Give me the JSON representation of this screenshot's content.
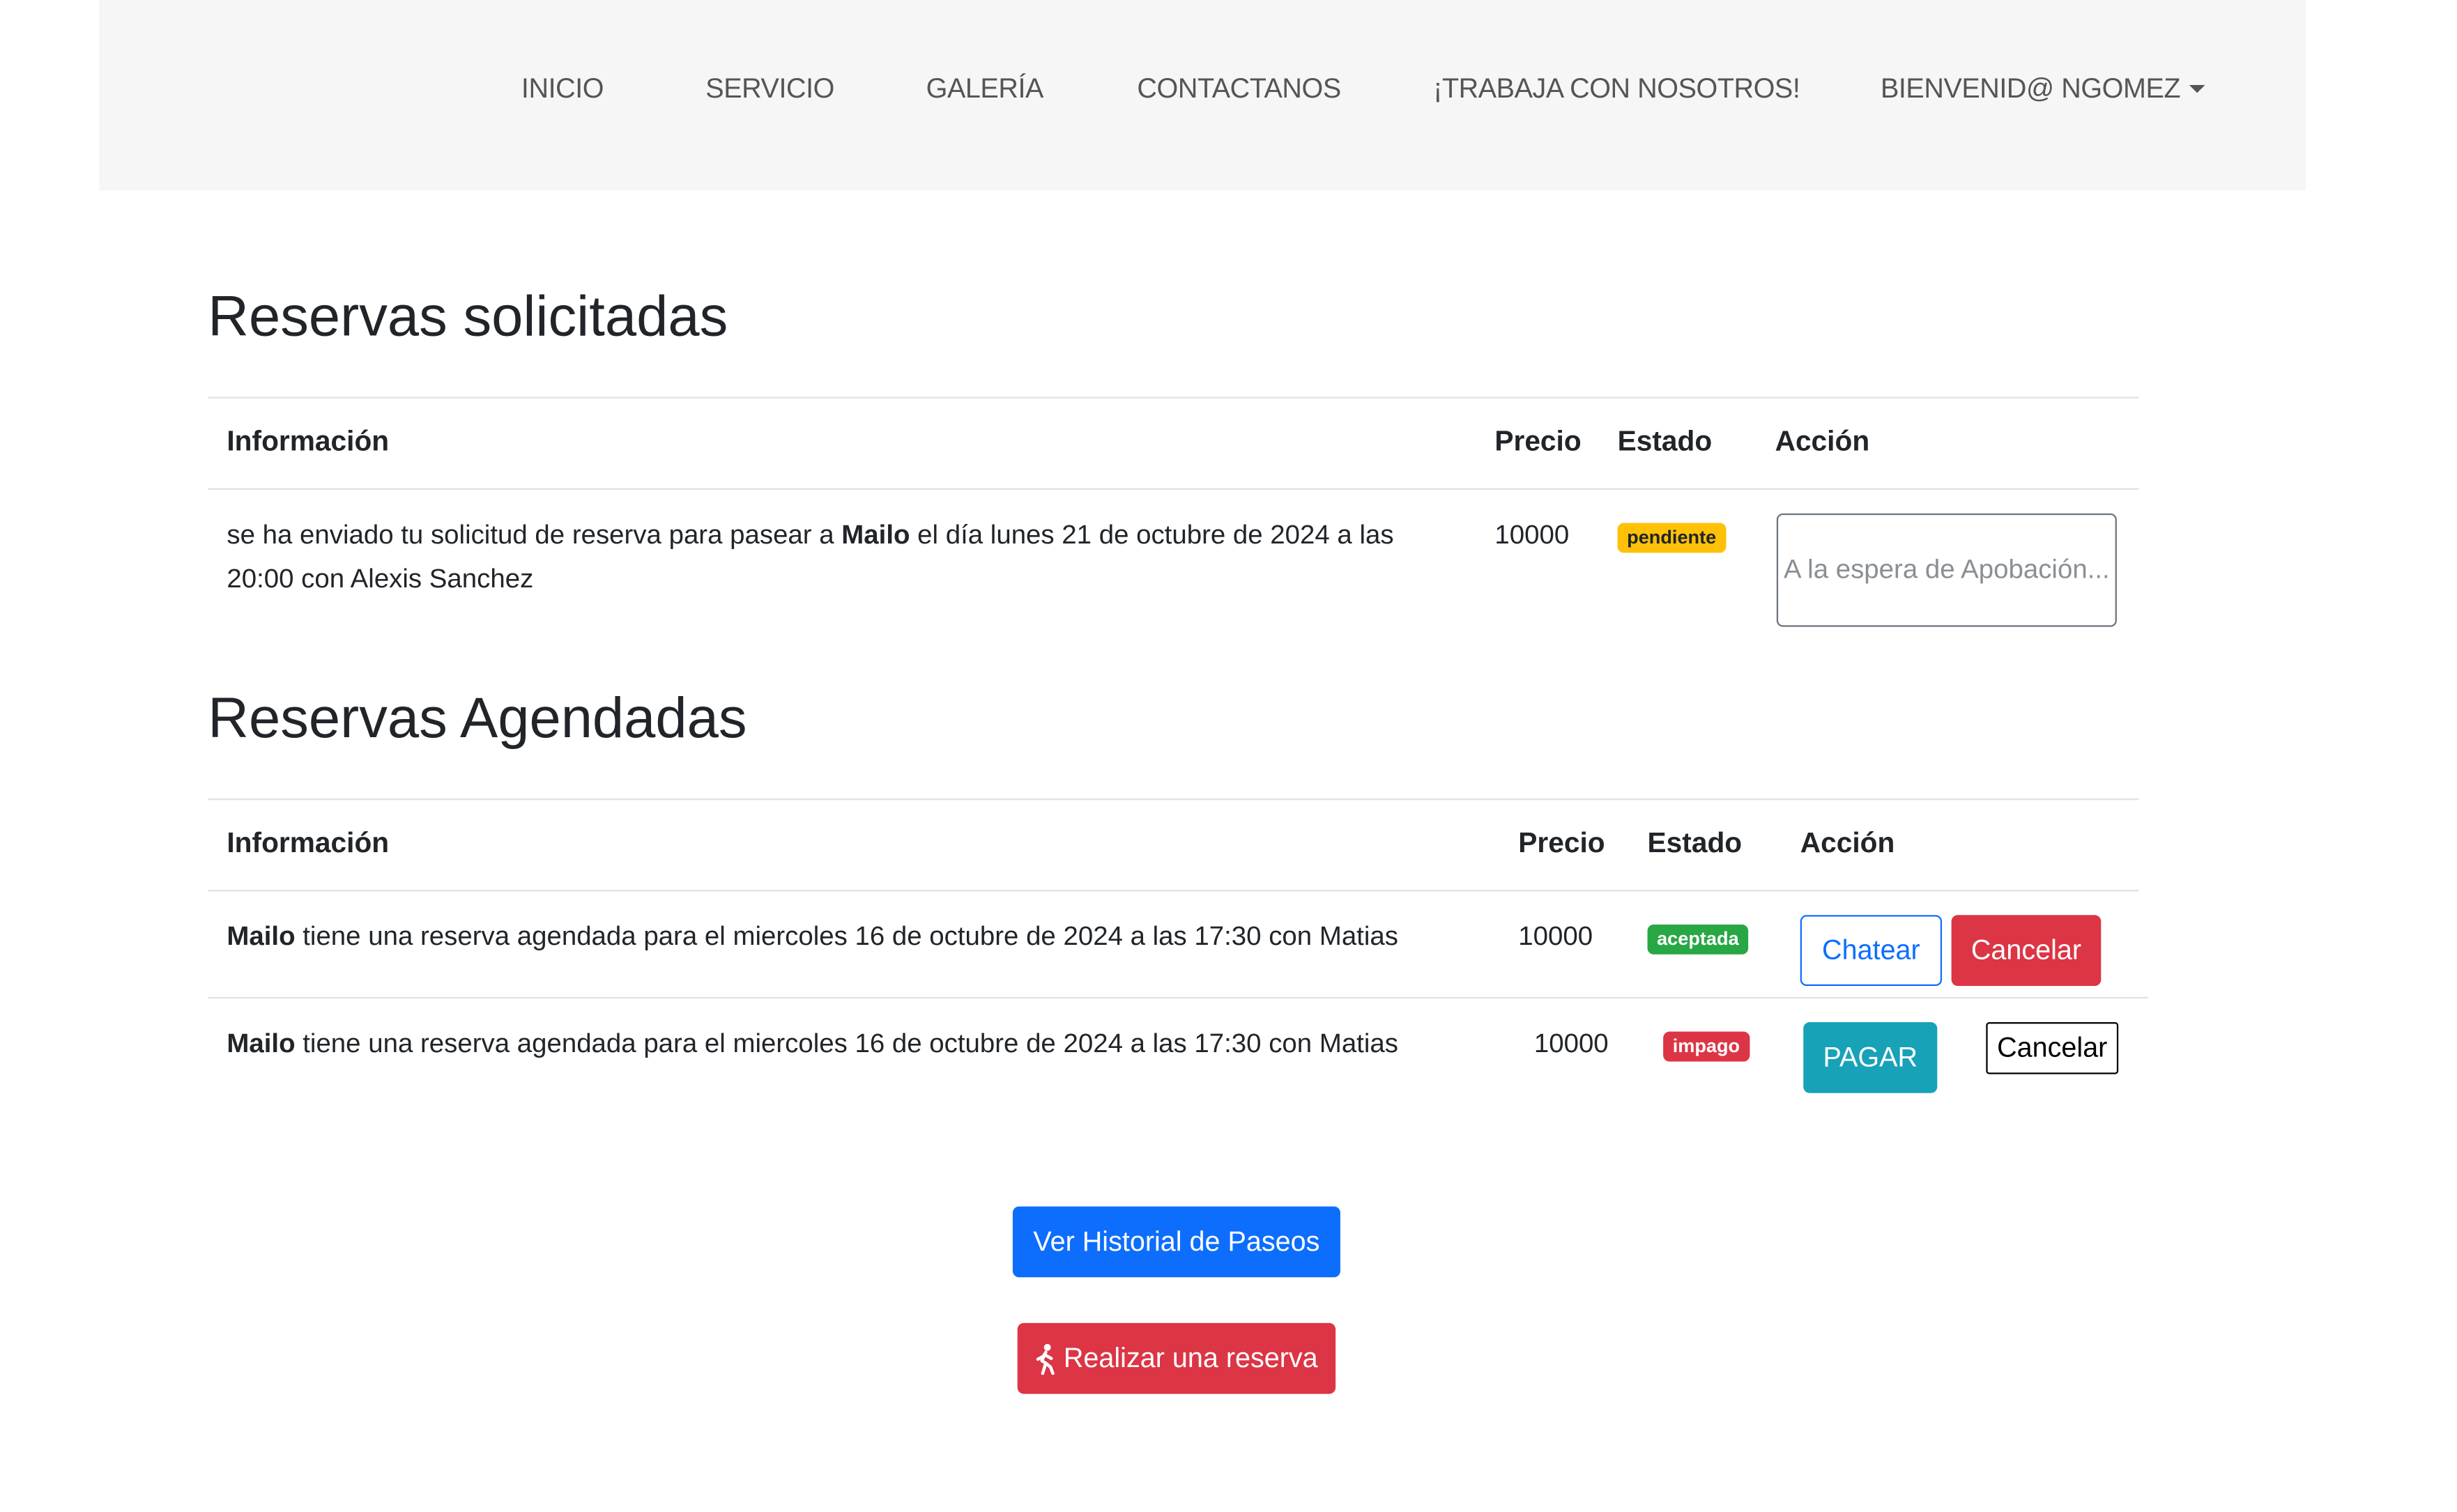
{
  "nav": {
    "items": [
      {
        "label": "INICIO"
      },
      {
        "label": "SERVICIO"
      },
      {
        "label": "GALERÍA"
      },
      {
        "label": "CONTACTANOS"
      },
      {
        "label": "¡TRABAJA CON NOSOTROS!"
      }
    ],
    "user_menu_label": "BIENVENID@ NGOMEZ"
  },
  "solicitadas": {
    "title": "Reservas solicitadas",
    "headers": {
      "info": "Información",
      "precio": "Precio",
      "estado": "Estado",
      "accion": "Acción"
    },
    "rows": [
      {
        "info_prefix": "se ha enviado tu solicitud de reserva para pasear a ",
        "pet": "Mailo",
        "info_suffix": " el día lunes 21 de octubre de 2024 a las 20:00 con Alexis Sanchez",
        "precio": "10000",
        "estado": "pendiente",
        "accion_label": "A la espera de Apobación..."
      }
    ]
  },
  "agendadas": {
    "title": "Reservas Agendadas",
    "headers": {
      "info": "Información",
      "precio": "Precio",
      "estado": "Estado",
      "accion": "Acción"
    },
    "rows": [
      {
        "pet": "Mailo",
        "info_suffix": " tiene una reserva agendada para el miercoles 16 de octubre de 2024 a las 17:30 con Matias",
        "precio": "10000",
        "estado": "aceptada",
        "chat_label": "Chatear",
        "cancel_label": "Cancelar"
      },
      {
        "pet": "Mailo",
        "info_suffix": " tiene una reserva agendada para el miercoles 16 de octubre de 2024 a las 17:30 con Matias",
        "precio": "10000",
        "estado": "impago",
        "pay_label": "PAGAR",
        "cancel_label": "Cancelar"
      }
    ]
  },
  "actions": {
    "history_label": "Ver Historial de Paseos",
    "reserve_label": "Realizar una reserva",
    "reserve_icon": "walking-person-icon"
  },
  "colors": {
    "primary": "#0d6efd",
    "danger": "#dc3545",
    "info": "#17a2b8",
    "success": "#28a745",
    "warning": "#ffc107"
  }
}
